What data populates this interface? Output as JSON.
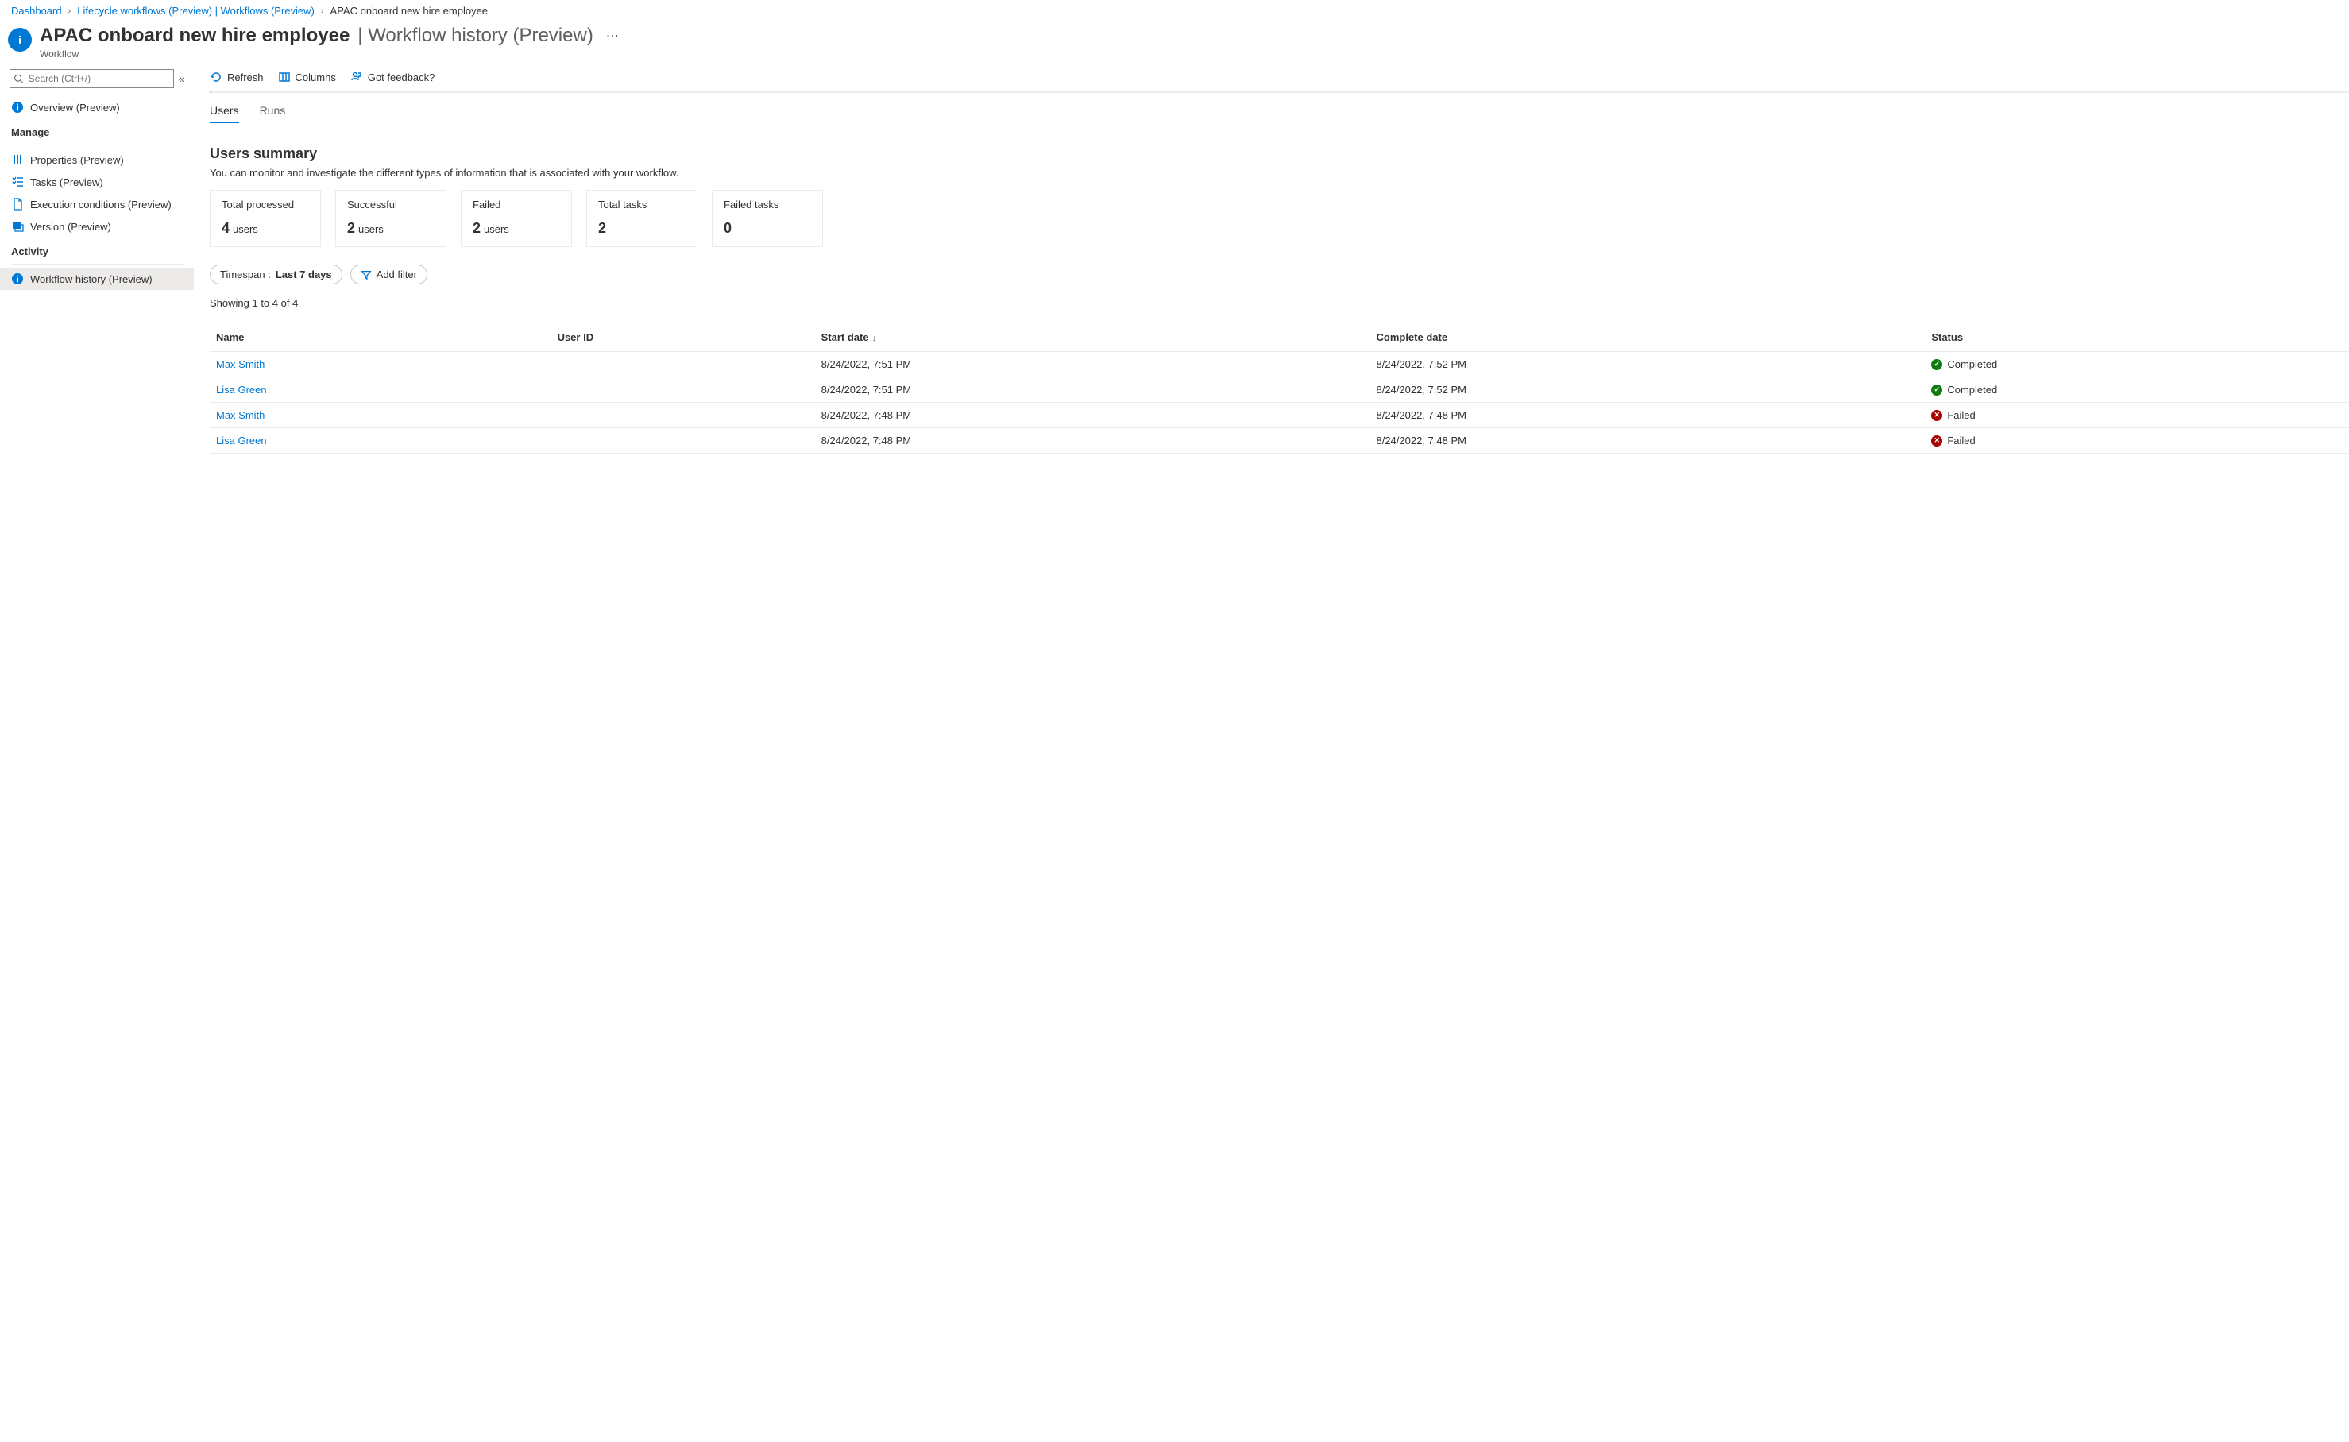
{
  "breadcrumb": {
    "items": [
      {
        "label": "Dashboard",
        "link": true
      },
      {
        "label": "Lifecycle workflows (Preview) | Workflows (Preview)",
        "link": true
      },
      {
        "label": "APAC onboard new hire employee",
        "link": false
      }
    ]
  },
  "header": {
    "title_main": "APAC onboard new hire employee",
    "title_sep": " | ",
    "title_sub": "Workflow history (Preview)",
    "subtitle": "Workflow"
  },
  "sidebar": {
    "search_placeholder": "Search (Ctrl+/)",
    "overview": "Overview (Preview)",
    "groups": {
      "manage": {
        "title": "Manage",
        "items": [
          {
            "label": "Properties (Preview)",
            "icon": "properties"
          },
          {
            "label": "Tasks (Preview)",
            "icon": "tasks"
          },
          {
            "label": "Execution conditions (Preview)",
            "icon": "doc"
          },
          {
            "label": "Version (Preview)",
            "icon": "version"
          }
        ]
      },
      "activity": {
        "title": "Activity",
        "items": [
          {
            "label": "Workflow history (Preview)",
            "icon": "info",
            "selected": true
          }
        ]
      }
    }
  },
  "toolbar": {
    "refresh": "Refresh",
    "columns": "Columns",
    "feedback": "Got feedback?"
  },
  "tabs": [
    {
      "label": "Users",
      "active": true
    },
    {
      "label": "Runs",
      "active": false
    }
  ],
  "summary": {
    "title": "Users summary",
    "desc": "You can monitor and investigate the different types of information that is associated with your workflow.",
    "cards": [
      {
        "label": "Total processed",
        "value": "4",
        "suffix": "users"
      },
      {
        "label": "Successful",
        "value": "2",
        "suffix": "users"
      },
      {
        "label": "Failed",
        "value": "2",
        "suffix": "users"
      },
      {
        "label": "Total tasks",
        "value": "2",
        "suffix": ""
      },
      {
        "label": "Failed tasks",
        "value": "0",
        "suffix": ""
      }
    ]
  },
  "filters": {
    "timespan_label": "Timespan : ",
    "timespan_value": "Last 7 days",
    "add_filter": "Add filter"
  },
  "result_count": "Showing 1 to 4 of 4",
  "table": {
    "columns": [
      "Name",
      "User ID",
      "Start date",
      "Complete date",
      "Status"
    ],
    "sort_col": 2,
    "rows": [
      {
        "name": "Max Smith",
        "userid": "",
        "start": "8/24/2022, 7:51 PM",
        "complete": "8/24/2022, 7:52 PM",
        "status": "Completed",
        "ok": true
      },
      {
        "name": "Lisa Green",
        "userid": "",
        "start": "8/24/2022, 7:51 PM",
        "complete": "8/24/2022, 7:52 PM",
        "status": "Completed",
        "ok": true
      },
      {
        "name": "Max Smith",
        "userid": "",
        "start": "8/24/2022, 7:48 PM",
        "complete": "8/24/2022, 7:48 PM",
        "status": "Failed",
        "ok": false
      },
      {
        "name": "Lisa Green",
        "userid": "",
        "start": "8/24/2022, 7:48 PM",
        "complete": "8/24/2022, 7:48 PM",
        "status": "Failed",
        "ok": false
      }
    ]
  }
}
